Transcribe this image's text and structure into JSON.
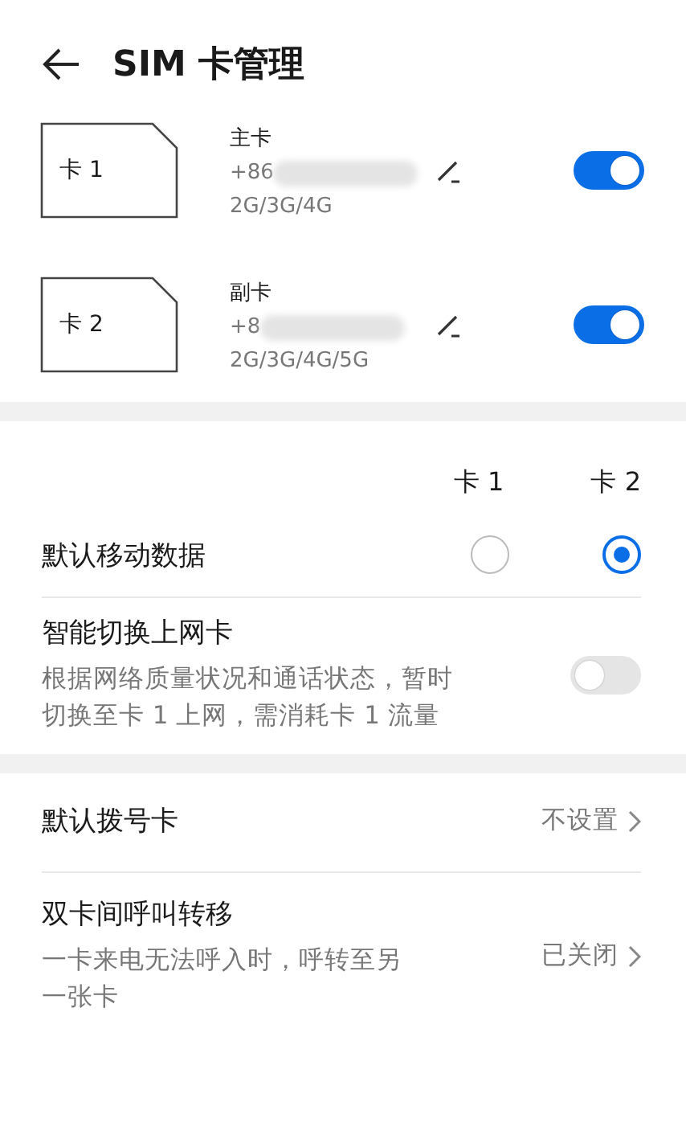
{
  "header": {
    "title": "SIM 卡管理"
  },
  "sim_cards": [
    {
      "slot_label": "卡 1",
      "role": "主卡",
      "number": "+86",
      "networks": "2G/3G/4G",
      "enabled": true
    },
    {
      "slot_label": "卡 2",
      "role": "副卡",
      "number": "+8",
      "networks": "2G/3G/4G/5G",
      "enabled": true
    }
  ],
  "data_card": {
    "columns": [
      "卡 1",
      "卡 2"
    ],
    "label": "默认移动数据",
    "options": [
      {
        "selected": false
      },
      {
        "selected": true
      }
    ]
  },
  "smart_switch": {
    "title": "智能切换上网卡",
    "description": "根据网络质量状况和通话状态，暂时切换至卡 1 上网，需消耗卡 1 流量",
    "on": false
  },
  "settings": [
    {
      "title": "默认拨号卡",
      "value": "不设置"
    },
    {
      "title": "双卡间呼叫转移",
      "description": "一卡来电无法呼入时，呼转至另一张卡",
      "value": "已关闭"
    }
  ]
}
